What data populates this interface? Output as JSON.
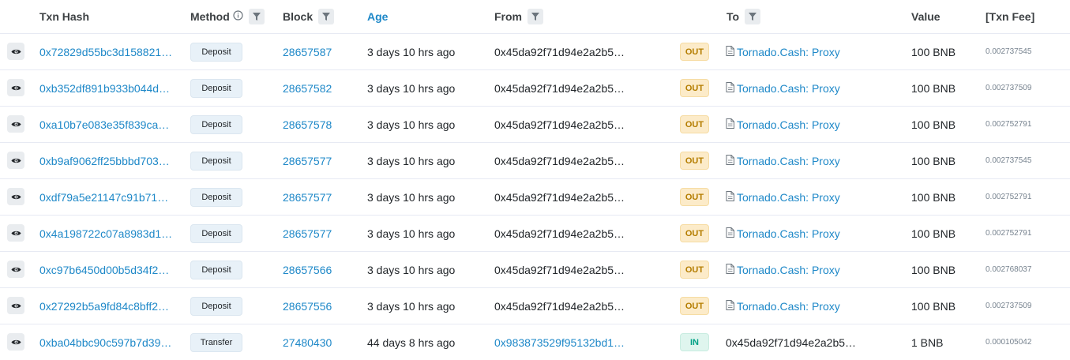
{
  "headers": {
    "txn_hash": "Txn Hash",
    "method": "Method",
    "block": "Block",
    "age": "Age",
    "from": "From",
    "to": "To",
    "value": "Value",
    "txn_fee": "[Txn Fee]"
  },
  "rows": [
    {
      "hash": "0x72829d55bc3d158821…",
      "method": "Deposit",
      "block": "28657587",
      "age": "3 days 10 hrs ago",
      "from": "0x45da92f71d94e2a2b5…",
      "from_link": false,
      "dir": "OUT",
      "to": "Tornado.Cash: Proxy",
      "to_contract": true,
      "value": "100 BNB",
      "fee": "0.002737545"
    },
    {
      "hash": "0xb352df891b933b044d…",
      "method": "Deposit",
      "block": "28657582",
      "age": "3 days 10 hrs ago",
      "from": "0x45da92f71d94e2a2b5…",
      "from_link": false,
      "dir": "OUT",
      "to": "Tornado.Cash: Proxy",
      "to_contract": true,
      "value": "100 BNB",
      "fee": "0.002737509"
    },
    {
      "hash": "0xa10b7e083e35f839ca…",
      "method": "Deposit",
      "block": "28657578",
      "age": "3 days 10 hrs ago",
      "from": "0x45da92f71d94e2a2b5…",
      "from_link": false,
      "dir": "OUT",
      "to": "Tornado.Cash: Proxy",
      "to_contract": true,
      "value": "100 BNB",
      "fee": "0.002752791"
    },
    {
      "hash": "0xb9af9062ff25bbbd703…",
      "method": "Deposit",
      "block": "28657577",
      "age": "3 days 10 hrs ago",
      "from": "0x45da92f71d94e2a2b5…",
      "from_link": false,
      "dir": "OUT",
      "to": "Tornado.Cash: Proxy",
      "to_contract": true,
      "value": "100 BNB",
      "fee": "0.002737545"
    },
    {
      "hash": "0xdf79a5e21147c91b71…",
      "method": "Deposit",
      "block": "28657577",
      "age": "3 days 10 hrs ago",
      "from": "0x45da92f71d94e2a2b5…",
      "from_link": false,
      "dir": "OUT",
      "to": "Tornado.Cash: Proxy",
      "to_contract": true,
      "value": "100 BNB",
      "fee": "0.002752791"
    },
    {
      "hash": "0x4a198722c07a8983d1…",
      "method": "Deposit",
      "block": "28657577",
      "age": "3 days 10 hrs ago",
      "from": "0x45da92f71d94e2a2b5…",
      "from_link": false,
      "dir": "OUT",
      "to": "Tornado.Cash: Proxy",
      "to_contract": true,
      "value": "100 BNB",
      "fee": "0.002752791"
    },
    {
      "hash": "0xc97b6450d00b5d34f2…",
      "method": "Deposit",
      "block": "28657566",
      "age": "3 days 10 hrs ago",
      "from": "0x45da92f71d94e2a2b5…",
      "from_link": false,
      "dir": "OUT",
      "to": "Tornado.Cash: Proxy",
      "to_contract": true,
      "value": "100 BNB",
      "fee": "0.002768037"
    },
    {
      "hash": "0x27292b5a9fd84c8bff2…",
      "method": "Deposit",
      "block": "28657556",
      "age": "3 days 10 hrs ago",
      "from": "0x45da92f71d94e2a2b5…",
      "from_link": false,
      "dir": "OUT",
      "to": "Tornado.Cash: Proxy",
      "to_contract": true,
      "value": "100 BNB",
      "fee": "0.002737509"
    },
    {
      "hash": "0xba04bbc90c597b7d39…",
      "method": "Transfer",
      "block": "27480430",
      "age": "44 days 8 hrs ago",
      "from": "0x983873529f95132bd1…",
      "from_link": true,
      "dir": "IN",
      "to": "0x45da92f71d94e2a2b5…",
      "to_contract": false,
      "value": "1 BNB",
      "fee": "0.000105042"
    }
  ],
  "colors": {
    "link": "#1e88c8",
    "out_badge_bg": "#fcebc9",
    "in_badge_bg": "#dff5ee"
  }
}
